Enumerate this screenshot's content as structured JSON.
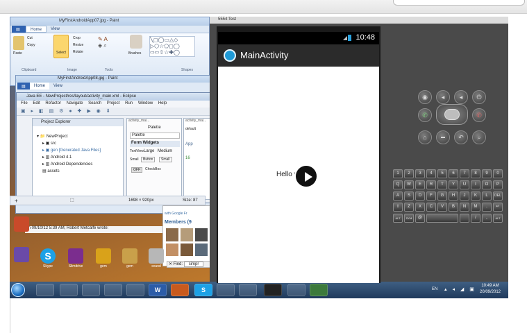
{
  "paint": {
    "title": "MyFirstAndroidApp07.jpg - Paint",
    "tabs": [
      "Home",
      "View"
    ],
    "groups": [
      "Clipboard",
      "Image",
      "Tools",
      "Shapes"
    ],
    "buttons": {
      "paste": "Paste",
      "cut": "Cut",
      "copy": "Copy",
      "select": "Select",
      "crop": "Crop",
      "resize": "Resize",
      "rotate": "Rotate",
      "brushes": "Brushes"
    }
  },
  "paint2": {
    "title": "MyFirstAndroidApp08.jpg - Paint",
    "tabs": [
      "Home",
      "View"
    ]
  },
  "eclipse": {
    "title": "Java EE - NewProject/res/layout/activity_main.xml - Eclipse",
    "menu": [
      "File",
      "Edit",
      "Refactor",
      "Navigate",
      "Search",
      "Project",
      "Run",
      "Window",
      "Help"
    ],
    "explorer_title": "Project Explorer",
    "tree": [
      "NewProject",
      "src",
      "gen [Generated Java Files]",
      "Android 4.1",
      "Android Dependencies",
      "assets"
    ],
    "editor_tabs": [
      "activity_mai...",
      "activity_mai..."
    ],
    "palette_title": "Palette",
    "palette_sections": [
      "Palette",
      "Form Widgets"
    ],
    "palette_items": [
      "TextView",
      "Large",
      "Medium",
      "Small",
      "Button",
      "Small",
      "OFF",
      "CheckBox"
    ],
    "preview_label": "default",
    "preview_app": "App",
    "preview_num": "16",
    "status_size1": "1698 × 920px",
    "status_size2": "Size: 87"
  },
  "email": {
    "line": "On 09/10/12 5:39 AM, Robert Metcalfe wrote:"
  },
  "members": {
    "google_text": "with Google Fr",
    "title": "Members (9"
  },
  "find": {
    "label": "Find:",
    "value": "simpr"
  },
  "desktop_icons": [
    {
      "label": "Skype",
      "color": "#1da1e6"
    },
    {
      "label": "Slimdrive",
      "color": "#7b2d8e"
    },
    {
      "label": "gem",
      "color": "#d9a21a"
    },
    {
      "label": "gem",
      "color": "#c9a04a"
    },
    {
      "label": "sound",
      "color": "#b7b7b7"
    }
  ],
  "taskbar": {
    "lang": "EN",
    "time": "10:49 AM",
    "date": "20/09/2012"
  },
  "emulator": {
    "title": "5554:Test",
    "clock": "10:48",
    "app_title": "MainActivity",
    "hello_text": "Hello w",
    "keyboard_rows": [
      [
        "1",
        "2",
        "3",
        "4",
        "5",
        "6",
        "7",
        "8",
        "9",
        "0"
      ],
      [
        "Q",
        "W",
        "E",
        "R",
        "T",
        "Y",
        "U",
        "I",
        "O",
        "P"
      ],
      [
        "A",
        "S",
        "D",
        "F",
        "G",
        "H",
        "J",
        "K",
        "L",
        "DEL"
      ],
      [
        "⇧",
        "Z",
        "X",
        "C",
        "V",
        "B",
        "N",
        "M",
        ".",
        "↵"
      ],
      [
        "ALT",
        "SYM",
        "@",
        "",
        "",
        "/",
        ",",
        "ALT"
      ]
    ]
  },
  "colors": {
    "android_bg": "#2b2b2b",
    "app_icon": "#1f9ad6",
    "taskbar": "#2a4a70"
  }
}
